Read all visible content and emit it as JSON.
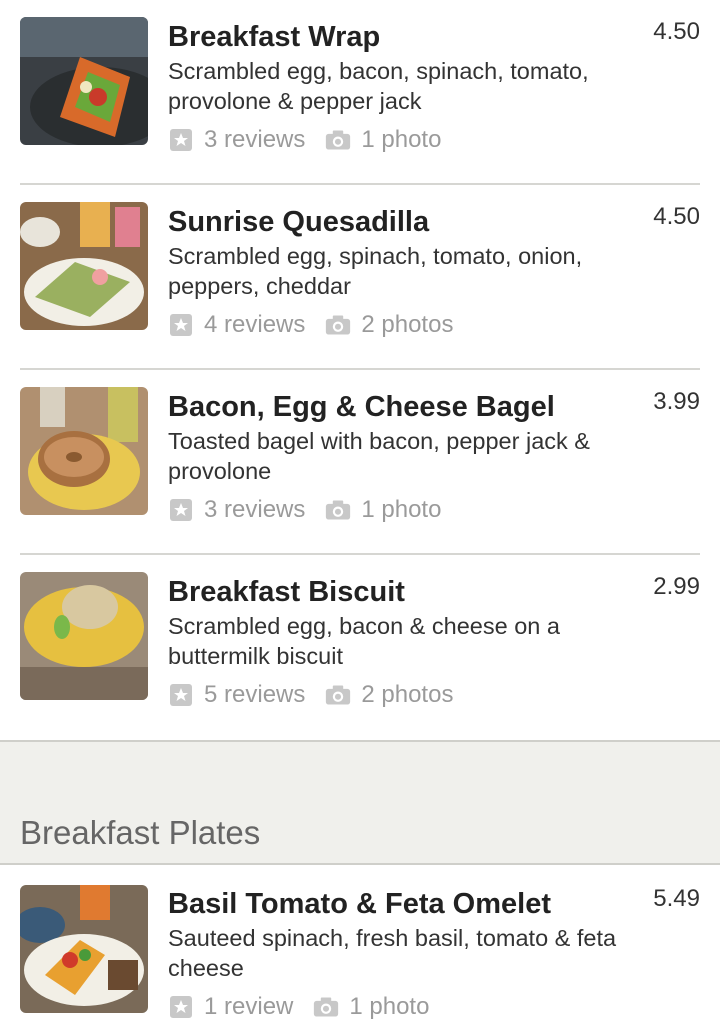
{
  "sections": [
    {
      "items": [
        {
          "title": "Breakfast Wrap",
          "desc": "Scrambled egg, bacon, spinach, tomato, provolone & pepper jack",
          "price": "4.50",
          "reviews": "3 reviews",
          "photos": "1 photo"
        },
        {
          "title": "Sunrise Quesadilla",
          "desc": "Scrambled egg, spinach, tomato, onion, peppers, cheddar",
          "price": "4.50",
          "reviews": "4 reviews",
          "photos": "2 photos"
        },
        {
          "title": "Bacon, Egg & Cheese Bagel",
          "desc": "Toasted bagel with bacon, pepper jack & provolone",
          "price": "3.99",
          "reviews": "3 reviews",
          "photos": "1 photo"
        },
        {
          "title": "Breakfast Biscuit",
          "desc": "Scrambled egg, bacon & cheese on a buttermilk biscuit",
          "price": "2.99",
          "reviews": "5 reviews",
          "photos": "2 photos"
        }
      ]
    },
    {
      "title": "Breakfast Plates",
      "items": [
        {
          "title": "Basil Tomato & Feta Omelet",
          "desc": "Sauteed spinach, fresh basil, tomato & feta cheese",
          "price": "5.49",
          "reviews": "1 review",
          "photos": "1 photo"
        }
      ]
    }
  ],
  "icons": {
    "review": "star-square-icon",
    "photo": "camera-icon"
  },
  "colors": {
    "meta_text": "#9a9a9a",
    "section_bg": "#f0f0ec",
    "divider": "#d6d6d2"
  }
}
